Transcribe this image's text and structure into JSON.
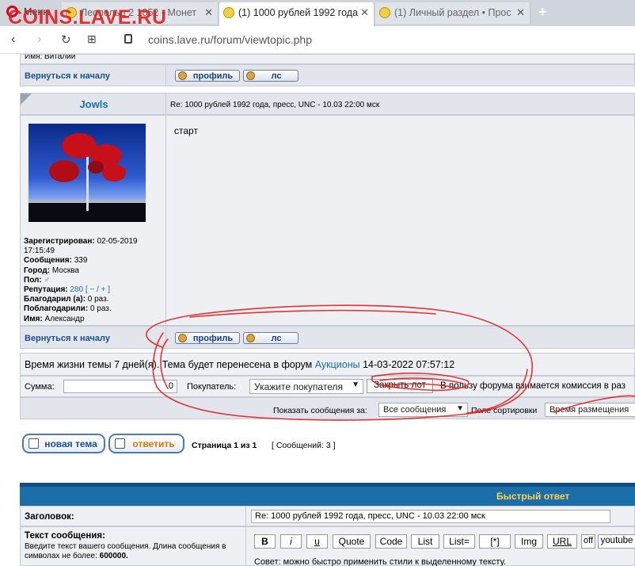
{
  "watermark": "COINS.LAVE.RU",
  "browser": {
    "menu_label": "Меню",
    "tabs": [
      {
        "title": "Леопольд 2 1852 - Монет"
      },
      {
        "title": "(1) 1000 рублей 1992 года"
      },
      {
        "title": "(1) Личный раздел • Прос"
      }
    ],
    "url": "coins.lave.ru/forum/viewtopic.php"
  },
  "prev_post": {
    "name_partial": "Имя: Виталий",
    "back_link": "Вернуться к началу",
    "profile_btn": "профиль",
    "pm_btn": "лс"
  },
  "post": {
    "author": "Jowls",
    "subject": "Re: 1000 рублей 1992 года, пресс, UNC - 10.03 22:00 мск",
    "body": "старт",
    "info": [
      {
        "label": "Зарегистрирован:",
        "value": "02-05-2019 17:15:49"
      },
      {
        "label": "Сообщения:",
        "value": "339"
      },
      {
        "label": "Город:",
        "value": "Москва"
      },
      {
        "label": "Пол:",
        "value": "♂"
      },
      {
        "label": "Репутация:",
        "value": "280"
      },
      {
        "label": "Благодарил (а):",
        "value": "0 раз."
      },
      {
        "label": "Поблагодарили:",
        "value": "0 раз."
      },
      {
        "label": "Имя:",
        "value": "Александр"
      }
    ],
    "rep_controls": "[ − / + ]",
    "back_link": "Вернуться к началу",
    "profile_btn": "профиль",
    "pm_btn": "лс"
  },
  "topic_life": {
    "text": "Время жизни темы 7 дней(я). Тема будет перенесена в форум",
    "forum_link": "Аукционы",
    "date": "14-03-2022 07:57:12"
  },
  "auction": {
    "sum_label": "Сумма:",
    "sum_value": "0",
    "buyer_label": "Покупатель:",
    "buyer_select": "Укажите покупателя",
    "close_lot_btn": "Закрыть лот",
    "commission_note": "В пользу форума взимается комиссия в раз"
  },
  "sort": {
    "show_label": "Показать сообщения за:",
    "show_value": "Все сообщения",
    "sort_label": "Поле сортировки",
    "sort_value": "Время размещения"
  },
  "actions": {
    "new_topic": "новая тема",
    "reply": "ответить",
    "page_info": "Страница 1 из 1",
    "msg_count": "[ Сообщений: 3 ]"
  },
  "quick_reply": {
    "header": "Быстрый ответ",
    "subject_label": "Заголовок:",
    "subject_value": "Re: 1000 рублей 1992 года, пресс, UNC - 10.03 22:00 мск",
    "text_label": "Текст сообщения:",
    "text_hint": "Введите текст вашего сообщения. Длина сообщения в символах не более:",
    "text_limit": "600000.",
    "toolbar": [
      "B",
      "i",
      "u",
      "Quote",
      "Code",
      "List",
      "List=",
      "[*]",
      "Img",
      "URL",
      "off",
      "youtube"
    ],
    "tip": "Совет: можно быстро применить стили к выделенному тексту."
  },
  "colors": {
    "accent": "#1b6ea8",
    "annotation": "#e02020",
    "link": "#1b4f8d"
  }
}
